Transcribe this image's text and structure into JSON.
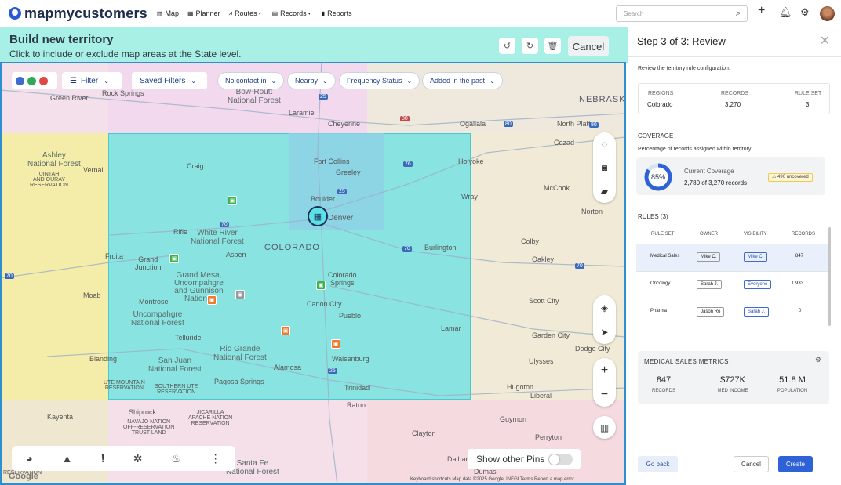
{
  "app": {
    "name": "mapmycustomers"
  },
  "nav": {
    "items": [
      {
        "label": "Map",
        "icon": "map-icon"
      },
      {
        "label": "Planner",
        "icon": "calendar-icon"
      },
      {
        "label": "Routes",
        "icon": "route-icon"
      },
      {
        "label": "Records",
        "icon": "records-icon"
      },
      {
        "label": "Reports",
        "icon": "chart-icon"
      }
    ],
    "search_placeholder": "Search"
  },
  "banner": {
    "title": "Build new territory",
    "subtitle": "Click to include or exclude map areas at the State level.",
    "cancel_label": "Cancel"
  },
  "filters": {
    "filter_label": "Filter",
    "saved_filters_label": "Saved Filters",
    "pills": [
      "No contact in",
      "Nearby",
      "Frequency Status",
      "Added in the past"
    ]
  },
  "map": {
    "state_label": "COLORADO",
    "neighbor_label": "NEBRASKA",
    "labels": {
      "green_river": "Green River",
      "rock_springs": "Rock Springs",
      "medicine_bow": "Medicine\nBow-Routt\nNational Forest",
      "laramie": "Laramie",
      "cheyenne": "Cheyenne",
      "ogallala": "Ogallala",
      "north_platte": "North Platte",
      "cozad": "Cozad",
      "ashley": "Ashley\nNational Forest",
      "vernal": "Vernal",
      "uintah": "UINTAH\nAND OURAY\nRESERVATION",
      "craig": "Craig",
      "fort_collins": "Fort Collins",
      "greeley": "Greeley",
      "holyoke": "Holyoke",
      "mccook": "McCook",
      "boulder": "Boulder",
      "denver": "Denver",
      "wray": "Wray",
      "norton": "Norton",
      "rifle": "Rifle",
      "white_river": "White River\nNational Forest",
      "aspen": "Aspen",
      "burlington": "Burlington",
      "colby": "Colby",
      "oakley": "Oakley",
      "fruita": "Fruita",
      "grand_junction": "Grand\nJunction",
      "grand_mesa": "Grand Mesa,\nUncompahgre\nand Gunnison\nNational",
      "colorado_springs": "Colorado\nSprings",
      "moab": "Moab",
      "montrose": "Montrose",
      "canon_city": "Canon City",
      "scott_city": "Scott City",
      "uncompahgre": "Uncompahgre\nNational Forest",
      "pueblo": "Pueblo",
      "telluride": "Telluride",
      "lamar": "Lamar",
      "garden_city": "Garden City",
      "rio_grande": "Rio Grande\nNational Forest",
      "dodge_city": "Dodge City",
      "blanding": "Blanding",
      "san_juan": "San Juan\nNational Forest",
      "walsenburg": "Walsenburg",
      "ulysses": "Ulysses",
      "alamosa": "Alamosa",
      "ute_mountain": "UTE MOUNTAIN\nRESERVATION",
      "southern_ute": "SOUTHERN UTE\nRESERVATION",
      "pagosa": "Pagosa Springs",
      "trinidad": "Trinidad",
      "hugoton": "Hugoton",
      "liberal": "Liberal",
      "kayenta": "Kayenta",
      "shiprock": "Shiprock",
      "navajo": "NAVAJO NATION\nOFF-RESERVATION\nTRUST LAND",
      "jicarilla": "JICARILLA\nAPACHE NATION\nRESERVATION",
      "raton": "Raton",
      "guymon": "Guymon",
      "clayton": "Clayton",
      "perryton": "Perryton",
      "dalhart": "Dalhart",
      "dumas": "Dumas",
      "santa_fe": "Santa Fe\nNational Forest",
      "navajo_res": "RESERVATION"
    },
    "show_pins_label": "Show other Pins",
    "attribution": "Keyboard shortcuts    Map data ©2025 Google, INEGI    Terms    Report a map error",
    "google": "Google",
    "colors": {
      "territory": "#7de3e0",
      "accent": "#2d8fd0"
    }
  },
  "panel": {
    "title": "Step 3 of 3: Review",
    "intro": "Review the territory rule configuration.",
    "summary": {
      "headers": [
        "REGIONS",
        "RECORDS",
        "RULE SET"
      ],
      "values": [
        "Colorado",
        "3,270",
        "3"
      ]
    },
    "coverage": {
      "heading": "COVERAGE",
      "description": "Percentage of records assigned within territory.",
      "percent": "85%",
      "percent_value": 85,
      "label": "Current Coverage",
      "detail": "2,780 of 3,270 records",
      "uncovered": "490 uncovered"
    },
    "rules": {
      "heading": "RULES (3)",
      "headers": [
        "RULE SET",
        "OWNER",
        "VISIBILITY",
        "RECORDS"
      ],
      "rows": [
        {
          "rule_set": "Medical Sales",
          "owner": "Mike C.",
          "visibility": "Mike C.",
          "records": "847"
        },
        {
          "rule_set": "Oncology",
          "owner": "Sarah J.",
          "visibility": "Everyone",
          "records": "1,933"
        },
        {
          "rule_set": "Pharma",
          "owner": "Jason Ro",
          "visibility": "Sarah J.",
          "records": "0"
        }
      ]
    },
    "metrics": {
      "title": "MEDICAL SALES METRICS",
      "items": [
        {
          "value": "847",
          "label": "RECORDS"
        },
        {
          "value": "$727K",
          "label": "MED INCOME"
        },
        {
          "value": "51.8 M",
          "label": "POPULATION"
        }
      ]
    },
    "footer": {
      "back": "Go back",
      "cancel": "Cancel",
      "create": "Create"
    }
  }
}
